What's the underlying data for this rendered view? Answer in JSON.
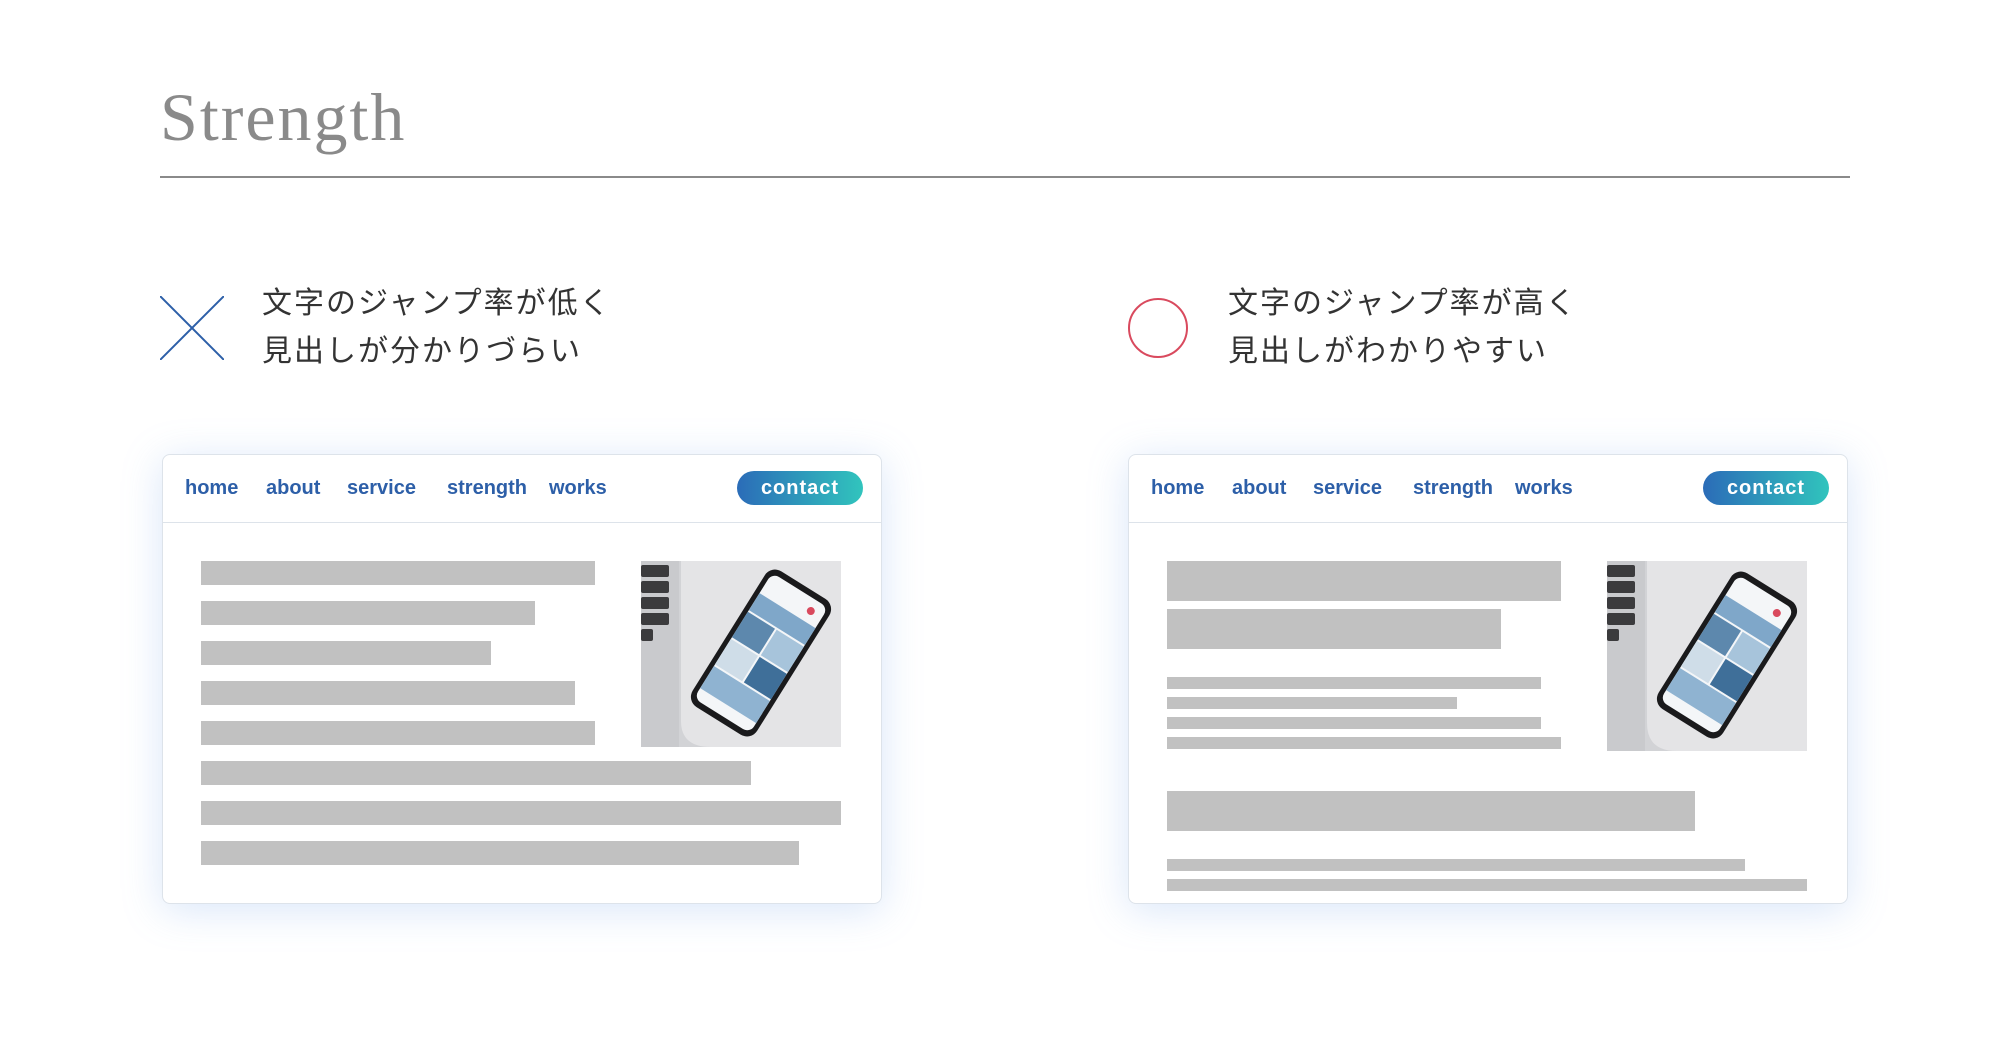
{
  "page": {
    "title": "Strength"
  },
  "bad_example": {
    "mark_icon": "x-cross-icon",
    "mark_color": "#2d5fa8",
    "caption_line1": "文字のジャンプ率が低く",
    "caption_line2": "見出しが分かりづらい"
  },
  "good_example": {
    "mark_icon": "circle-icon",
    "mark_color": "#d94a5e",
    "caption_line1": "文字のジャンプ率が高く",
    "caption_line2": "見出しがわかりやすい"
  },
  "mockup_nav": {
    "home": "home",
    "about": "about",
    "service": "service",
    "strength": "strength",
    "works": "works",
    "contact": "contact"
  },
  "colors": {
    "nav_link": "#2d5fa8",
    "contact_gradient_start": "#2b6cb8",
    "contact_gradient_end": "#31c4bd",
    "placeholder_bar": "#c1c1c1"
  }
}
